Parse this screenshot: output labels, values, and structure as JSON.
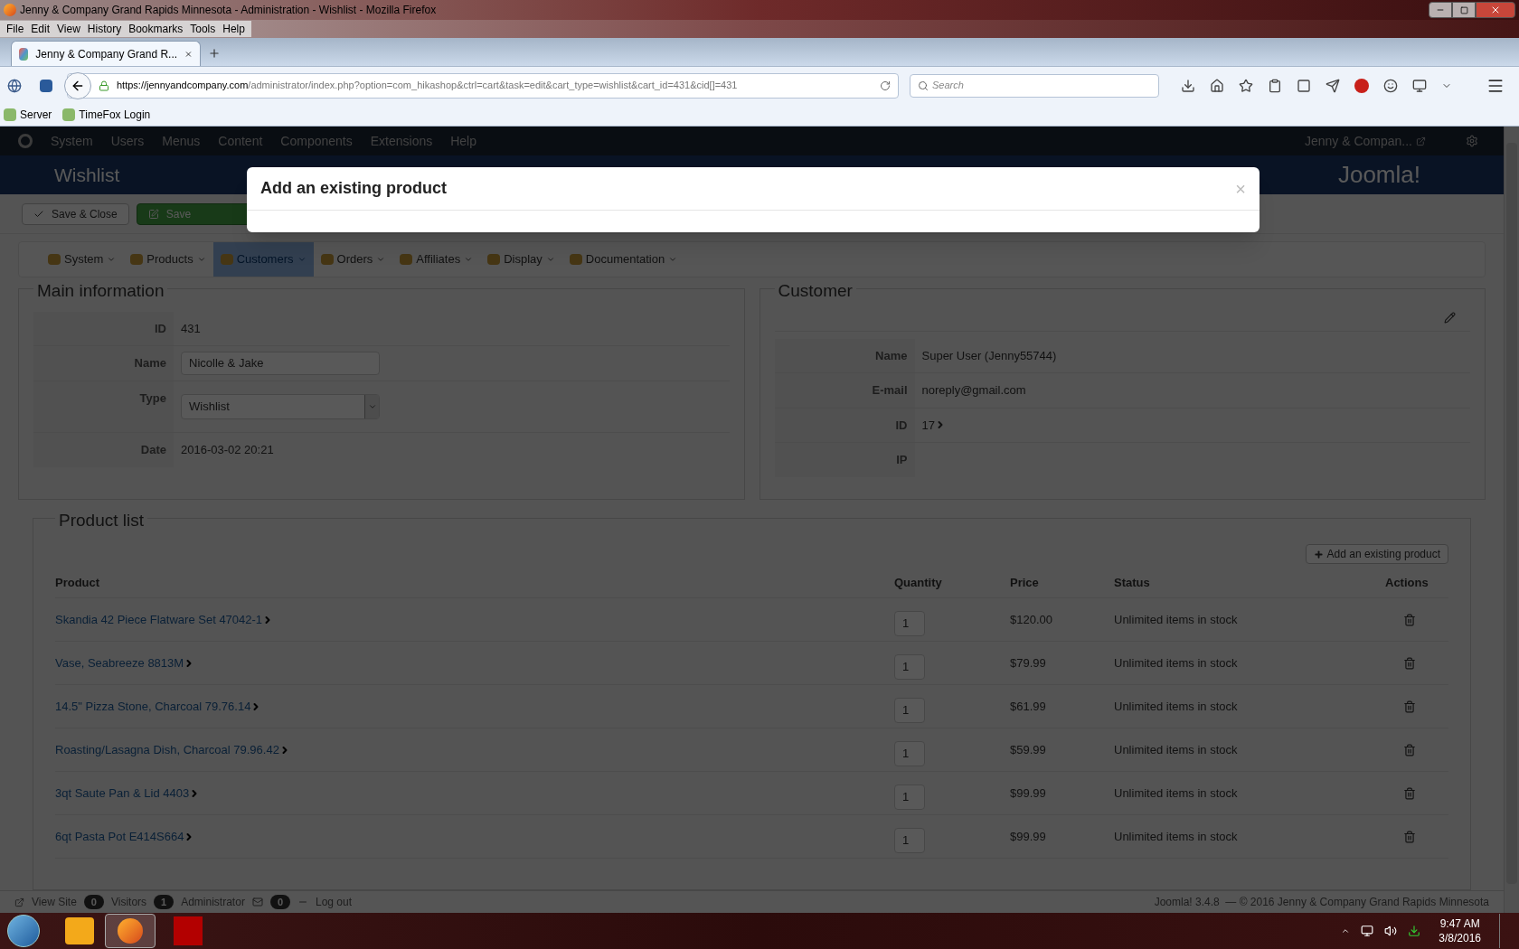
{
  "window": {
    "title": "Jenny & Company Grand Rapids Minnesota - Administration - Wishlist - Mozilla Firefox"
  },
  "menu_bar": [
    "File",
    "Edit",
    "View",
    "History",
    "Bookmarks",
    "Tools",
    "Help"
  ],
  "tabs": [
    {
      "label": "Jenny & Company Grand R...",
      "selected": true
    }
  ],
  "address": {
    "host": "https://jennyandcompany.com",
    "path": "/administrator/index.php?option=com_hikashop&ctrl=cart&task=edit&cart_type=wishlist&cart_id=431&cid[]=431"
  },
  "search": {
    "placeholder": "Search"
  },
  "bookmarks": [
    "Server",
    "TimeFox Login"
  ],
  "admin_nav": {
    "items": [
      "System",
      "Users",
      "Menus",
      "Content",
      "Components",
      "Extensions",
      "Help"
    ],
    "user": "Jenny & Compan..."
  },
  "page_title": "Wishlist",
  "toolbar": [
    {
      "label": "Save & Close",
      "kind": "default"
    },
    {
      "label": "Save",
      "kind": "success"
    }
  ],
  "submenu": [
    {
      "label": "System",
      "selected": false
    },
    {
      "label": "Products",
      "selected": false
    },
    {
      "label": "Customers",
      "selected": true
    },
    {
      "label": "Orders",
      "selected": false
    },
    {
      "label": "Affiliates",
      "selected": false
    },
    {
      "label": "Display",
      "selected": false
    },
    {
      "label": "Documentation",
      "selected": false
    }
  ],
  "main_information": {
    "title": "Main information",
    "fields": [
      {
        "label": "ID",
        "value": "431",
        "kind": "text"
      },
      {
        "label": "Name",
        "value": "Nicolle & Jake",
        "kind": "input"
      },
      {
        "label": "Type",
        "value": "Wishlist",
        "kind": "select"
      },
      {
        "label": "Date",
        "value": "2016-03-02 20:21",
        "kind": "text"
      }
    ]
  },
  "customer": {
    "title": "Customer",
    "fields": [
      {
        "label": "Name",
        "value": "Super User (Jenny55744)",
        "kind": "text"
      },
      {
        "label": "E-mail",
        "value": "noreply@gmail.com",
        "kind": "text"
      },
      {
        "label": "ID",
        "value": "17",
        "kind": "link"
      },
      {
        "label": "IP",
        "kind": "text"
      }
    ]
  },
  "product_list": {
    "title": "Product list",
    "add_button": "Add an existing product",
    "columns": [
      "Product",
      "Quantity",
      "Price",
      "Status",
      "Actions"
    ],
    "rows": [
      {
        "product": "Skandia 42 Piece Flatware Set 47042-1",
        "quantity": "1",
        "price": "$120.00",
        "status": "Unlimited items in stock"
      },
      {
        "product": "Vase, Seabreeze 8813M",
        "quantity": "1",
        "price": "$79.99",
        "status": "Unlimited items in stock"
      },
      {
        "product": "14.5\" Pizza Stone, Charcoal 79.76.14",
        "quantity": "1",
        "price": "$61.99",
        "status": "Unlimited items in stock"
      },
      {
        "product": "Roasting/Lasagna Dish, Charcoal 79.96.42",
        "quantity": "1",
        "price": "$59.99",
        "status": "Unlimited items in stock"
      },
      {
        "product": "3qt Saute Pan & Lid 4403",
        "quantity": "1",
        "price": "$99.99",
        "status": "Unlimited items in stock"
      },
      {
        "product": "6qt Pasta Pot E414S664",
        "quantity": "1",
        "price": "$99.99",
        "status": "Unlimited items in stock"
      }
    ]
  },
  "status_bar": {
    "view_site": "View Site",
    "visitors_count": "0",
    "visitors": "Visitors",
    "admin_count": "1",
    "admin": "Administrator",
    "messages_count": "0",
    "logout": "Log out",
    "copyright": "Joomla! 3.4.8  — © 2016 Jenny & Company Grand Rapids Minnesota"
  },
  "modal": {
    "title": "Add an existing product",
    "close": "×"
  },
  "joomla_logo": "Joomla!",
  "taskbar": {
    "time": "9:47 AM",
    "date": "3/8/2016"
  }
}
